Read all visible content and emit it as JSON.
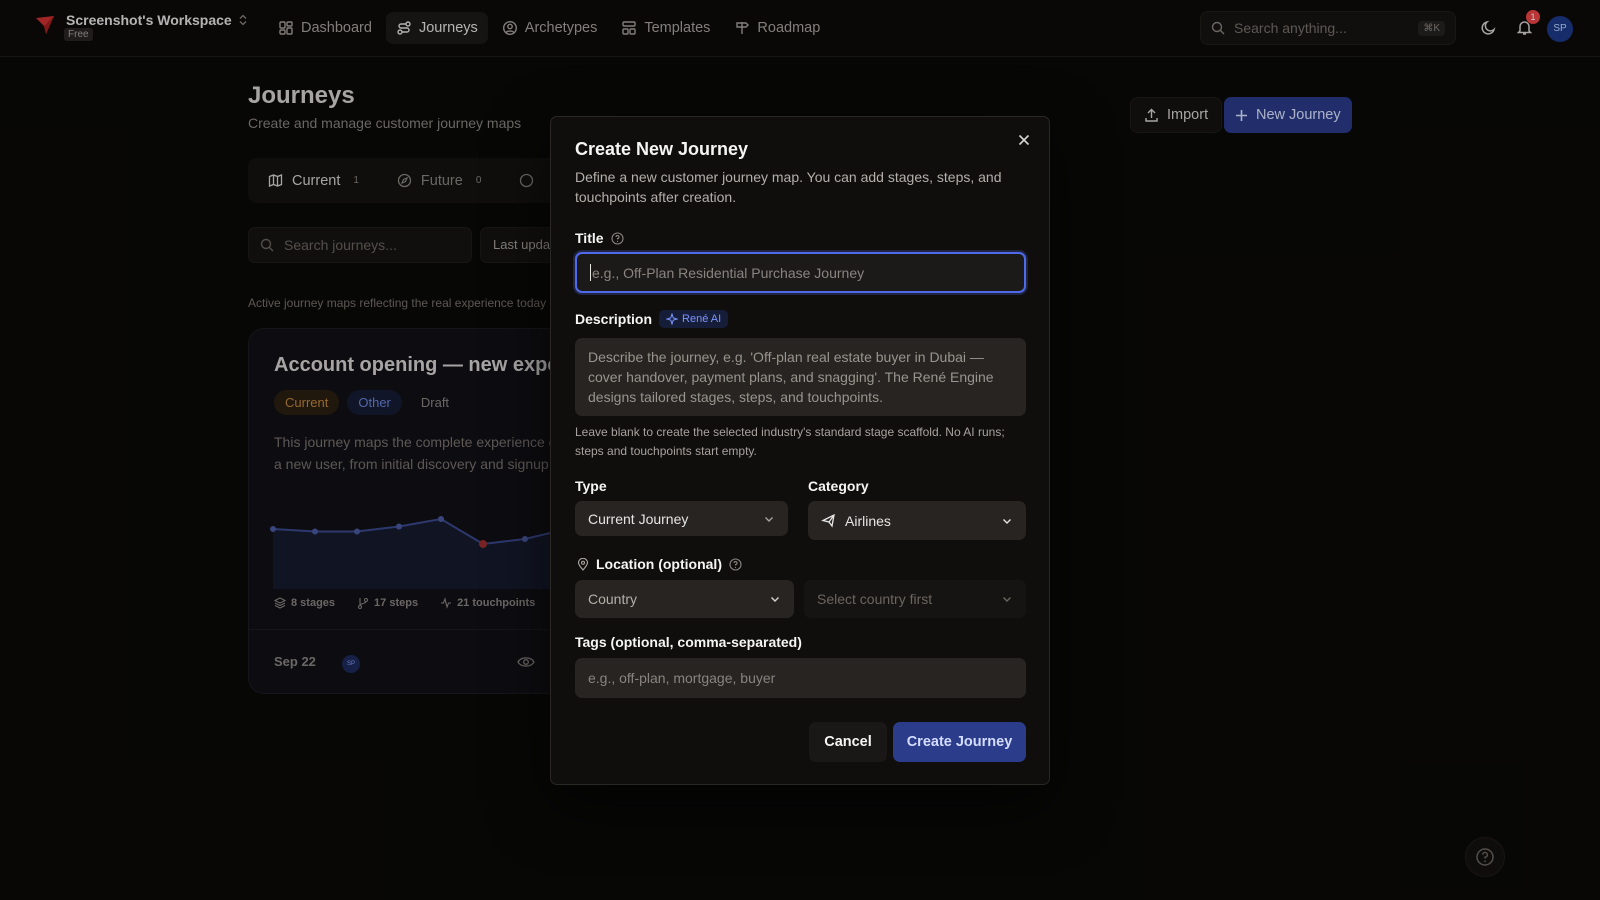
{
  "workspace": {
    "name": "Screenshot's Workspace",
    "plan": "Free"
  },
  "nav": [
    {
      "label": "Dashboard",
      "icon": "grid-icon",
      "active": false
    },
    {
      "label": "Journeys",
      "icon": "route-icon",
      "active": true
    },
    {
      "label": "Archetypes",
      "icon": "user-circle-icon",
      "active": false
    },
    {
      "label": "Templates",
      "icon": "layout-icon",
      "active": false
    },
    {
      "label": "Roadmap",
      "icon": "signpost-icon",
      "active": false
    }
  ],
  "search": {
    "placeholder": "Search anything...",
    "shortcut": "⌘K"
  },
  "notifications": {
    "count": "1"
  },
  "user": {
    "initials": "SP"
  },
  "page": {
    "title": "Journeys",
    "subtitle": "Create and manage customer journey maps",
    "import_label": "Import",
    "new_label": "New Journey",
    "tabs": [
      {
        "label": "Current",
        "count": "1"
      },
      {
        "label": "Future",
        "count": "0"
      }
    ],
    "search_placeholder": "Search journeys...",
    "sort_label": "Last updated",
    "note": "Active journey maps reflecting the real experience today"
  },
  "card": {
    "title": "Account opening — new experience",
    "chips": [
      "Current",
      "Other",
      "Draft"
    ],
    "desc_line1": "This journey maps the complete experience of",
    "desc_line2": "a new user, from initial discovery and signup",
    "stats": {
      "stages": "8 stages",
      "steps": "17 steps",
      "touchpoints": "21 touchpoints"
    },
    "date": "Sep 22",
    "avatar": "SP",
    "sentiment": [
      0.0,
      -0.1,
      -0.1,
      0.1,
      0.4,
      -0.6,
      -0.4,
      0.0
    ]
  },
  "modal": {
    "title": "Create New Journey",
    "description": "Define a new customer journey map. You can add stages, steps, and touchpoints after creation.",
    "title_label": "Title",
    "title_placeholder": "e.g., Off-Plan Residential Purchase Journey",
    "description_label": "Description",
    "ai_badge": "René AI",
    "description_placeholder": "Describe the journey, e.g. 'Off-plan real estate buyer in Dubai — cover handover, payment plans, and snagging'. The René Engine designs tailored stages, steps, and touchpoints.",
    "hint": "Leave blank to create the selected industry's standard stage scaffold. No AI runs; steps and touchpoints start empty.",
    "type_label": "Type",
    "type_value": "Current Journey",
    "category_label": "Category",
    "category_value": "Airlines",
    "location_label": "Location (optional)",
    "country_placeholder": "Country",
    "city_placeholder": "Select country first",
    "tags_label": "Tags (optional, comma-separated)",
    "tags_placeholder": "e.g., off-plan, mortgage, buyer",
    "cancel_label": "Cancel",
    "create_label": "Create Journey"
  },
  "colors": {
    "accent": "#4f6ae8",
    "primary_button": "#2b3c8a",
    "notification": "#ef4444"
  }
}
